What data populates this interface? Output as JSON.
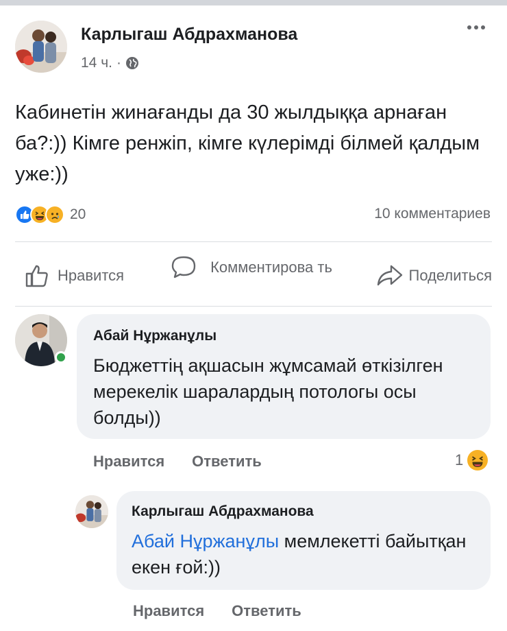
{
  "post": {
    "author": "Карлыгаш Абдрахманова",
    "time": "14 ч.",
    "separator": "·",
    "text": "Кабинетін жинағанды да 30 жылдыққа арнаған ба?:)) Кімге ренжіп, кімге күлерімді білмей қалдым уже:))",
    "reactions_count": "20",
    "comments_count": "10 комментариев"
  },
  "actions": {
    "like": "Нравится",
    "comment": "Комментирова ть",
    "share": "Поделиться"
  },
  "comments": [
    {
      "author": "Абай Нұржанұлы",
      "text": "Бюджеттің ақшасын жұмсамай өткізілген мерекелік шаралардың потологы осы болды))",
      "like_label": "Нравится",
      "reply_label": "Ответить",
      "reaction_count": "1"
    },
    {
      "author": "Карлыгаш Абдрахманова",
      "mention": "Абай Нұржанұлы",
      "text": " мемлекетті байытқан екен ғой:))",
      "like_label": "Нравится",
      "reply_label": "Ответить"
    }
  ],
  "icons": {
    "more": "more-options-icon",
    "privacy": "globe-icon",
    "like": "thumbs-up-icon",
    "comment": "speech-bubble-icon",
    "share": "share-arrow-icon"
  },
  "colors": {
    "like_blue": "#1877f2",
    "reaction_yellow": "#f7b125",
    "mention_blue": "#216fdb",
    "online_green": "#31a24c"
  }
}
